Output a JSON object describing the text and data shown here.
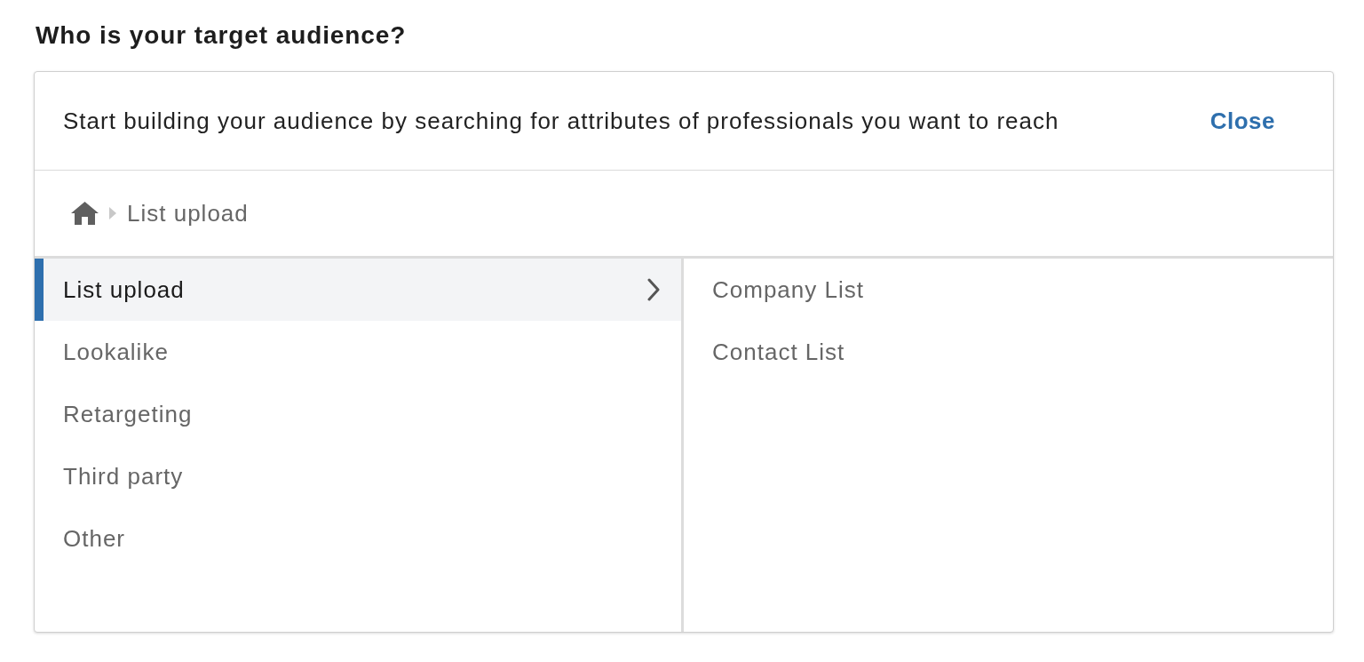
{
  "title": "Who is your target audience?",
  "panel": {
    "prompt": "Start building your audience by searching for attributes of professionals you want to reach",
    "close_label": "Close",
    "breadcrumb": [
      "List upload"
    ],
    "categories": [
      {
        "label": "List upload",
        "selected": true
      },
      {
        "label": "Lookalike",
        "selected": false
      },
      {
        "label": "Retargeting",
        "selected": false
      },
      {
        "label": "Third party",
        "selected": false
      },
      {
        "label": "Other",
        "selected": false
      }
    ],
    "options": [
      "Company List",
      "Contact List"
    ]
  }
}
